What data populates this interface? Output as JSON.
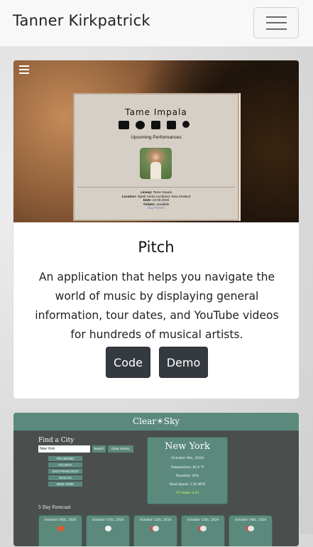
{
  "navbar": {
    "brand": "Tanner Kirkpatrick",
    "toggle_icon": "hamburger-menu-icon"
  },
  "project_pitch": {
    "title": "Pitch",
    "description": "An application that helps you navigate the world of music by displaying general information, tour dates, and YouTube videos for hundreds of musical artists.",
    "buttons": {
      "code": "Code",
      "demo": "Demo"
    },
    "preview": {
      "menu_icon": "hamburger-menu-icon",
      "artist": "Tame Impala",
      "icons": [
        "youtube-icon",
        "info-icon",
        "calendar-icon",
        "list-icon",
        "search-icon"
      ],
      "subtitle": "Upcoming Performances",
      "event": {
        "lineup_label": "Lineup:",
        "lineup": "Tame Impala",
        "location_label": "Location:",
        "location": "Spark Arena Auckland, New Zealand",
        "date_label": "Date:",
        "date": "12-05-2020",
        "tickets_label": "Tickets:",
        "tickets": "available",
        "link": "Buy Tickets"
      }
    }
  },
  "project_weather": {
    "logo": "Clear☀Sky",
    "find_label": "Find a City",
    "search_value": "New York",
    "search_button": "Search",
    "clear_button": "Clear History",
    "cities": [
      "RICHMOND",
      "ATLANTA",
      "SAN FRANCISCO",
      "DALLAS",
      "NEW YORK"
    ],
    "current": {
      "city": "New York",
      "date": "October 9th, 2020",
      "temperature": "Temperature: 60.4 °F",
      "humidity": "Humidity: 43%",
      "wind": "Wind Speed: 3.36 MPH",
      "uv": "UV Index: 4.41"
    },
    "forecast_label": "5 Day Forecast",
    "forecast_dates": [
      "October 10th, 2020",
      "October 11th, 2020",
      "October 12th, 2020",
      "October 13th, 2020",
      "October 14th, 2020"
    ]
  }
}
